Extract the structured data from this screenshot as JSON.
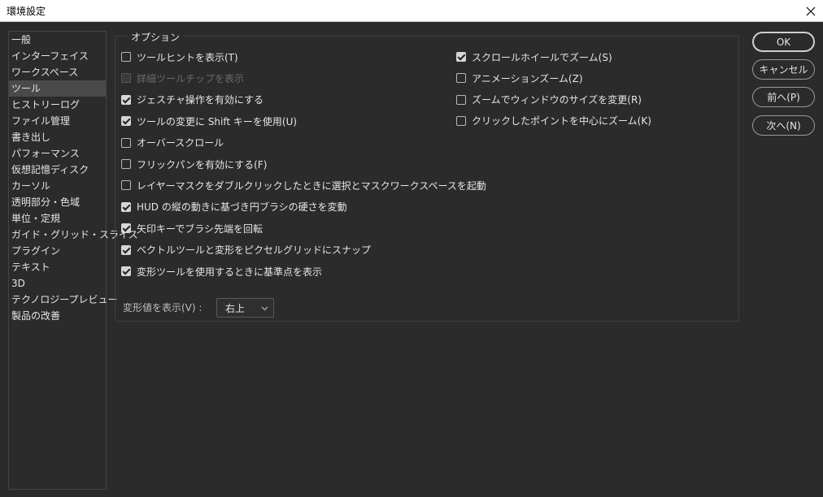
{
  "window": {
    "title": "環境設定"
  },
  "sidebar": {
    "items": [
      {
        "label": "一般"
      },
      {
        "label": "インターフェイス"
      },
      {
        "label": "ワークスペース"
      },
      {
        "label": "ツール",
        "selected": true
      },
      {
        "label": "ヒストリーログ"
      },
      {
        "label": "ファイル管理"
      },
      {
        "label": "書き出し"
      },
      {
        "label": "パフォーマンス"
      },
      {
        "label": "仮想記憶ディスク"
      },
      {
        "label": "カーソル"
      },
      {
        "label": "透明部分・色域"
      },
      {
        "label": "単位・定規"
      },
      {
        "label": "ガイド・グリッド・スライス"
      },
      {
        "label": "プラグイン"
      },
      {
        "label": "テキスト"
      },
      {
        "label": "3D"
      },
      {
        "label": "テクノロジープレビュー"
      },
      {
        "label": "製品の改善"
      }
    ]
  },
  "options": {
    "title": "オプション",
    "left": [
      {
        "label": "ツールヒントを表示(T)",
        "checked": false
      },
      {
        "label": "詳細ツールチップを表示",
        "checked": false,
        "disabled": true
      },
      {
        "label": "ジェスチャ操作を有効にする",
        "checked": true
      },
      {
        "label": "ツールの変更に Shift キーを使用(U)",
        "checked": true
      },
      {
        "label": "オーバースクロール",
        "checked": false
      },
      {
        "label": "フリックパンを有効にする(F)",
        "checked": false
      },
      {
        "label": "レイヤーマスクをダブルクリックしたときに選択とマスクワークスペースを起動",
        "checked": false
      },
      {
        "label": "HUD の縦の動きに基づき円ブラシの硬さを変動",
        "checked": true
      },
      {
        "label": "矢印キーでブラシ先端を回転",
        "checked": true
      },
      {
        "label": "ベクトルツールと変形をピクセルグリッドにスナップ",
        "checked": true
      },
      {
        "label": "変形ツールを使用するときに基準点を表示",
        "checked": true
      }
    ],
    "right": [
      {
        "label": "スクロールホイールでズーム(S)",
        "checked": true
      },
      {
        "label": "アニメーションズーム(Z)",
        "checked": false
      },
      {
        "label": "ズームでウィンドウのサイズを変更(R)",
        "checked": false
      },
      {
        "label": "クリックしたポイントを中心にズーム(K)",
        "checked": false
      }
    ],
    "transform_values": {
      "label": "変形値を表示(V) :",
      "value": "右上"
    }
  },
  "buttons": {
    "ok": "OK",
    "cancel": "キャンセル",
    "prev": "前へ(P)",
    "next": "次へ(N)"
  }
}
